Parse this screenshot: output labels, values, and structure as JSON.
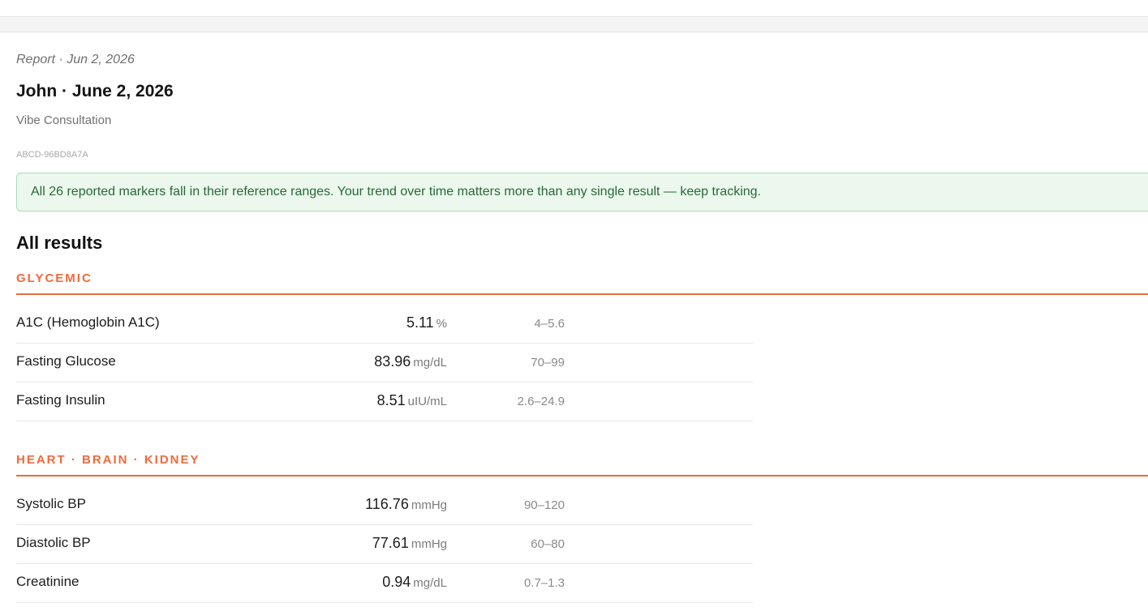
{
  "header": {
    "report_meta": "Report · Jun 2, 2026",
    "title": "John · June 2, 2026",
    "subtitle": "Vibe Consultation",
    "report_id": "ABCD-96BD8A7A"
  },
  "summary": {
    "text": "All 26 reported markers fall in their reference ranges. Your trend over time matters more than any single result — keep tracking.",
    "status_color": "#256a37"
  },
  "results": {
    "heading": "All results",
    "accent_color": "#f06a3a",
    "groups": [
      {
        "title": "GLYCEMIC",
        "rows": [
          {
            "marker": "A1C (Hemoglobin A1C)",
            "value": "5.11",
            "unit": "%",
            "range": "4–5.6"
          },
          {
            "marker": "Fasting Glucose",
            "value": "83.96",
            "unit": "mg/dL",
            "range": "70–99"
          },
          {
            "marker": "Fasting Insulin",
            "value": "8.51",
            "unit": "uIU/mL",
            "range": "2.6–24.9"
          }
        ]
      },
      {
        "title": "HEART · BRAIN · KIDNEY",
        "rows": [
          {
            "marker": "Systolic BP",
            "value": "116.76",
            "unit": "mmHg",
            "range": "90–120"
          },
          {
            "marker": "Diastolic BP",
            "value": "77.61",
            "unit": "mmHg",
            "range": "60–80"
          },
          {
            "marker": "Creatinine",
            "value": "0.94",
            "unit": "mg/dL",
            "range": "0.7–1.3"
          }
        ]
      }
    ]
  }
}
